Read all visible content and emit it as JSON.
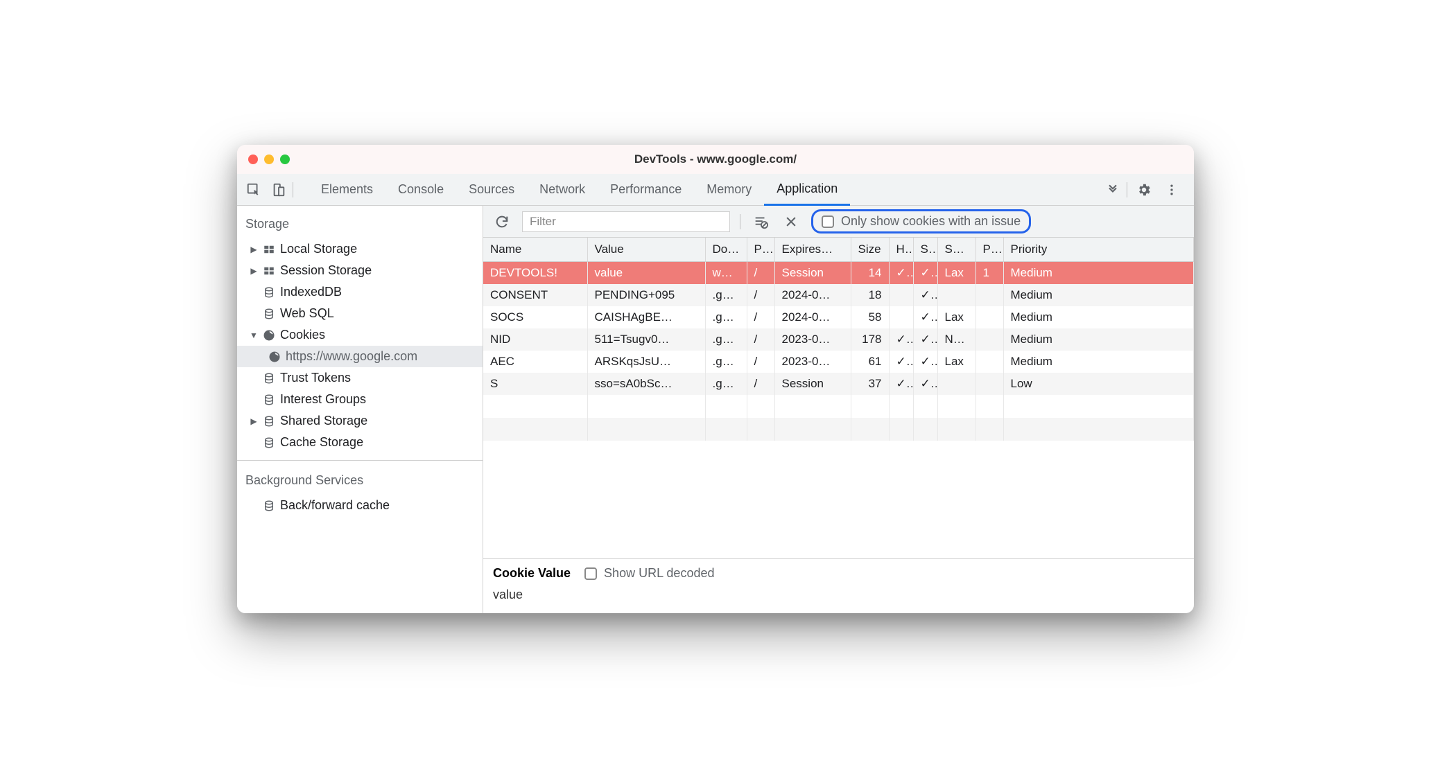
{
  "window": {
    "title": "DevTools - www.google.com/"
  },
  "tabs": {
    "items": [
      "Elements",
      "Console",
      "Sources",
      "Network",
      "Performance",
      "Memory",
      "Application"
    ],
    "active": "Application"
  },
  "sidebar": {
    "sections": [
      {
        "header": "Storage",
        "items": [
          {
            "label": "Local Storage",
            "icon": "table",
            "expandable": true,
            "expanded": false
          },
          {
            "label": "Session Storage",
            "icon": "table",
            "expandable": true,
            "expanded": false
          },
          {
            "label": "IndexedDB",
            "icon": "db",
            "expandable": false
          },
          {
            "label": "Web SQL",
            "icon": "db",
            "expandable": false
          },
          {
            "label": "Cookies",
            "icon": "cookie",
            "expandable": true,
            "expanded": true,
            "children": [
              {
                "label": "https://www.google.com",
                "icon": "cookie",
                "selected": true
              }
            ]
          },
          {
            "label": "Trust Tokens",
            "icon": "db",
            "expandable": false
          },
          {
            "label": "Interest Groups",
            "icon": "db",
            "expandable": false
          },
          {
            "label": "Shared Storage",
            "icon": "db",
            "expandable": true,
            "expanded": false
          },
          {
            "label": "Cache Storage",
            "icon": "db",
            "expandable": false
          }
        ]
      },
      {
        "header": "Background Services",
        "items": [
          {
            "label": "Back/forward cache",
            "icon": "db",
            "expandable": false
          }
        ]
      }
    ]
  },
  "toolbar": {
    "filter_placeholder": "Filter",
    "only_issues_label": "Only show cookies with an issue"
  },
  "cookies": {
    "columns": [
      "Name",
      "Value",
      "Do…",
      "P…",
      "Expires…",
      "Size",
      "H.",
      "S…",
      "Sa…",
      "P…",
      "Priority"
    ],
    "rows": [
      {
        "name": "DEVTOOLS!",
        "value": "value",
        "domain": "ww…",
        "path": "/",
        "expires": "Session",
        "size": "14",
        "http": "✓",
        "secure": "✓",
        "samesite": "Lax",
        "party": "1",
        "priority": "Medium",
        "selected": true
      },
      {
        "name": "CONSENT",
        "value": "PENDING+095",
        "domain": ".go…",
        "path": "/",
        "expires": "2024-0…",
        "size": "18",
        "http": "",
        "secure": "✓",
        "samesite": "",
        "party": "",
        "priority": "Medium"
      },
      {
        "name": "SOCS",
        "value": "CAISHAgBE…",
        "domain": ".go…",
        "path": "/",
        "expires": "2024-0…",
        "size": "58",
        "http": "",
        "secure": "✓",
        "samesite": "Lax",
        "party": "",
        "priority": "Medium"
      },
      {
        "name": "NID",
        "value": "511=Tsugv0…",
        "domain": ".go…",
        "path": "/",
        "expires": "2023-0…",
        "size": "178",
        "http": "✓",
        "secure": "✓",
        "samesite": "No…",
        "party": "",
        "priority": "Medium"
      },
      {
        "name": "AEC",
        "value": "ARSKqsJsU…",
        "domain": ".go…",
        "path": "/",
        "expires": "2023-0…",
        "size": "61",
        "http": "✓",
        "secure": "✓",
        "samesite": "Lax",
        "party": "",
        "priority": "Medium"
      },
      {
        "name": "S",
        "value": "sso=sA0bSc…",
        "domain": ".go…",
        "path": "/",
        "expires": "Session",
        "size": "37",
        "http": "✓",
        "secure": "✓",
        "samesite": "",
        "party": "",
        "priority": "Low"
      }
    ]
  },
  "detail": {
    "title": "Cookie Value",
    "url_decoded_label": "Show URL decoded",
    "value": "value"
  },
  "icons": {
    "check": "✓"
  }
}
